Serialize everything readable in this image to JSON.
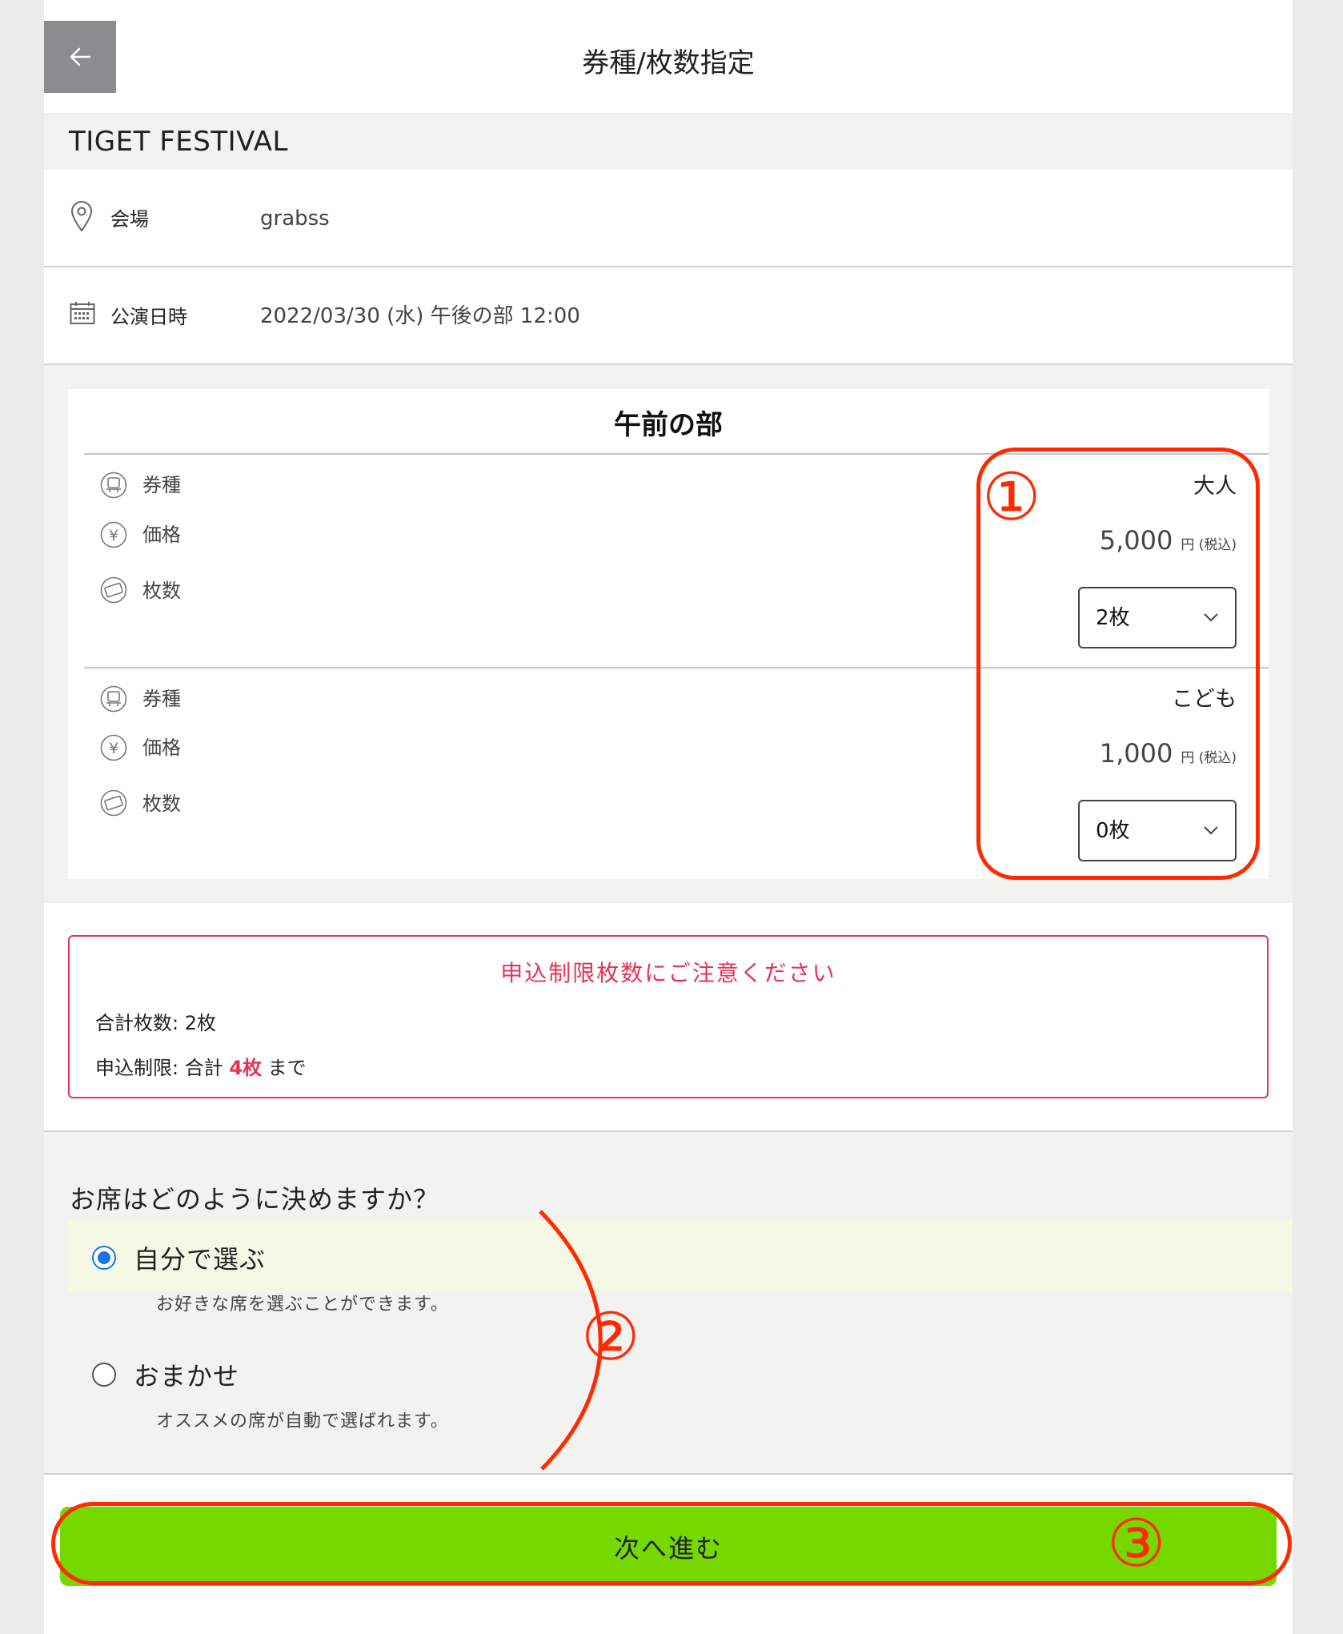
{
  "header": {
    "title": "券種/枚数指定",
    "back_icon": "arrow-left-icon"
  },
  "event": {
    "name": "TIGET FESTIVAL"
  },
  "info": {
    "venue": {
      "label": "会場",
      "value": "grabss",
      "icon": "map-pin-icon"
    },
    "date": {
      "label": "公演日時",
      "value": "2022/03/30 (水) 午後の部 12:00",
      "icon": "calendar-icon"
    }
  },
  "session": {
    "title": "午前の部",
    "labels": {
      "type": "券種",
      "price": "価格",
      "quantity": "枚数"
    },
    "tickets": [
      {
        "type": "大人",
        "price": "5,000",
        "unit": "円 (税込)",
        "quantity": "2枚"
      },
      {
        "type": "こども",
        "price": "1,000",
        "unit": "円 (税込)",
        "quantity": "0枚"
      }
    ]
  },
  "limit": {
    "title": "申込制限枚数にご注意ください",
    "total": "合計枚数: 2枚",
    "line_prefix": "申込制限: 合計 ",
    "line_highlight": "4枚",
    "line_suffix": " まで"
  },
  "seat": {
    "question": "お席はどのように決めますか？",
    "options": [
      {
        "label": "自分で選ぶ",
        "desc": "お好きな席を選ぶことができます。",
        "selected": true
      },
      {
        "label": "おまかせ",
        "desc": "オススメの席が自動で選ばれます。",
        "selected": false
      }
    ]
  },
  "next_button": {
    "label": "次へ進む"
  },
  "annotations": {
    "one": "①",
    "two": "②",
    "three": "③"
  },
  "colors": {
    "accent_red": "#e8315a",
    "button_green": "#77d800",
    "radio_blue": "#1677e0",
    "annotation_red": "#ff2a00"
  }
}
